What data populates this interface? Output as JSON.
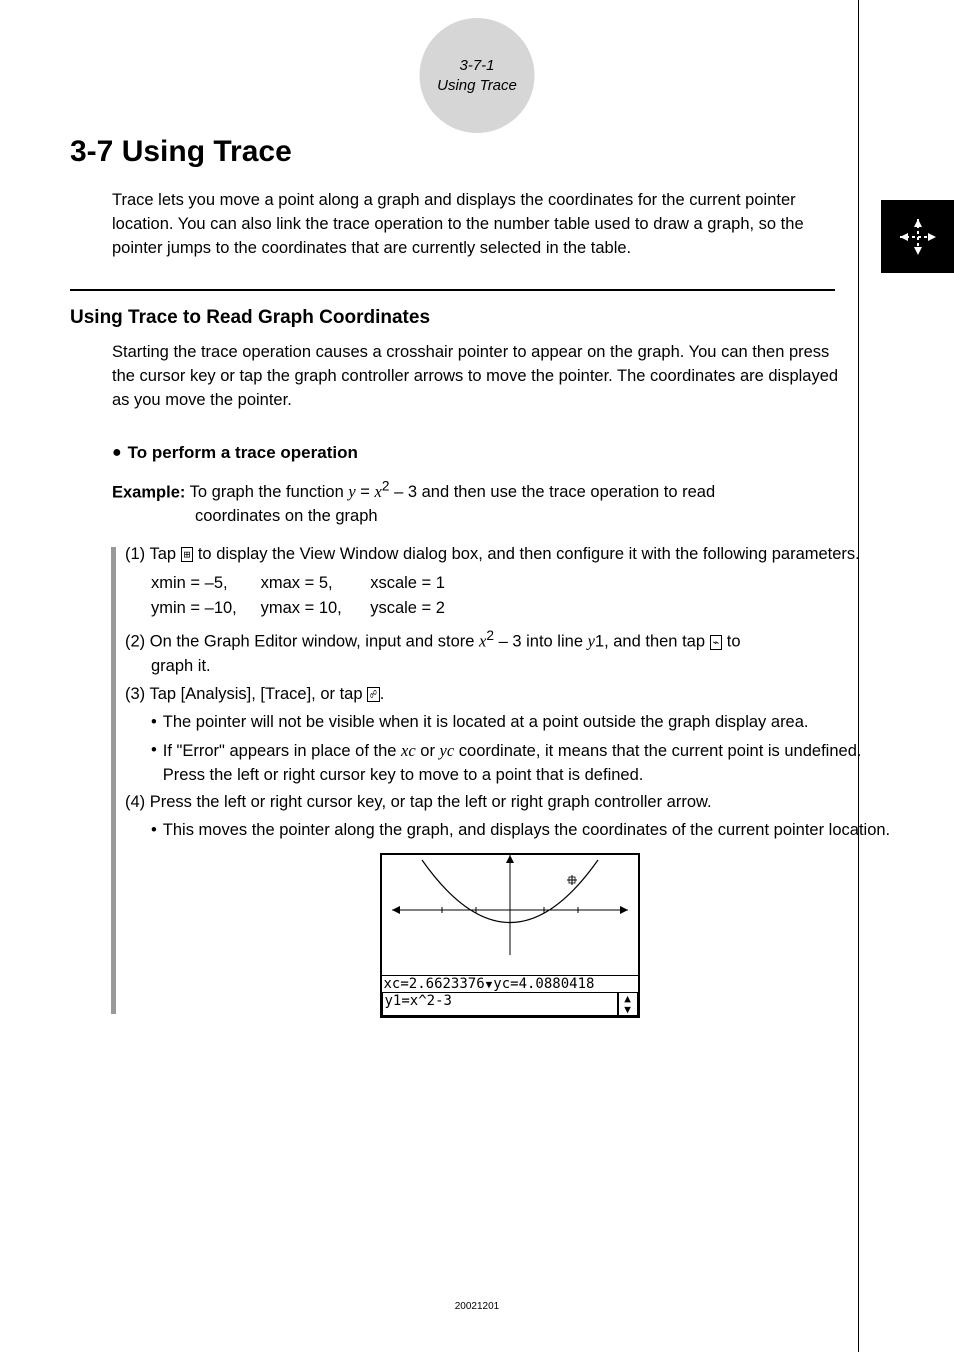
{
  "badge": {
    "line1": "3-7-1",
    "line2": "Using Trace"
  },
  "title": "3-7  Using Trace",
  "intro": "Trace lets you move a point along a graph and displays the coordinates for the current pointer location. You can also link the trace operation to the number table used to draw a graph, so the pointer jumps to the coordinates that are currently selected in the table.",
  "section_heading": "Using Trace to Read Graph Coordinates",
  "section_intro": "Starting the trace operation causes a crosshair pointer to appear on the graph. You can then press the cursor key or tap the graph controller arrows to move the pointer. The coordinates are displayed as you move the pointer.",
  "procedure_heading": "To perform a trace operation",
  "example": {
    "label": "Example:",
    "line1_a": "To graph the function ",
    "line1_eq_lhs": "y",
    "line1_eq_eq": " = ",
    "line1_eq_rhs_base": "x",
    "line1_eq_rhs_exp": "2",
    "line1_eq_tail": " – 3 and then use the trace operation to read",
    "line2": "coordinates on the graph"
  },
  "steps": {
    "s1": {
      "num": "(1) ",
      "a": "Tap ",
      "icon": "view-window-icon",
      "b": " to display the View Window dialog box, and then configure it with the following parameters.",
      "params": {
        "xmin": "xmin = –5,",
        "xmax": "xmax = 5,",
        "xscale": "xscale = 1",
        "ymin": "ymin = –10,",
        "ymax": "ymax = 10,",
        "yscale": "yscale = 2"
      }
    },
    "s2": {
      "num": "(2) ",
      "a": "On the Graph Editor window, input and store ",
      "eq_base": "x",
      "eq_exp": "2",
      "eq_tail": " – 3 into line ",
      "yvar": "y",
      "ytail": "1, and then tap ",
      "icon": "graph-icon",
      "b": " to",
      "cont": "graph it."
    },
    "s3": {
      "num": "(3) ",
      "a": "Tap [Analysis], [Trace], or tap ",
      "icon": "trace-icon",
      "b": ".",
      "bullet1": "The pointer will not be visible when it is located at a point outside the graph display area.",
      "bullet2a": "If \"Error\" appears in place of the ",
      "xc": "xc",
      "or": " or ",
      "yc": "yc",
      "bullet2b": " coordinate, it means that the current point is undefined. Press the left or right cursor key to move to a point that is defined."
    },
    "s4": {
      "num": "(4) ",
      "a": "Press the left or right cursor key, or tap the left or right graph controller arrow.",
      "bullet1": "This moves the pointer along the graph, and displays the coordinates of the current pointer location."
    }
  },
  "figure": {
    "xc": "xc=2.6623376",
    "yc": "yc=4.0880418",
    "eq": "y1=x^2-3"
  },
  "footer": "20021201"
}
